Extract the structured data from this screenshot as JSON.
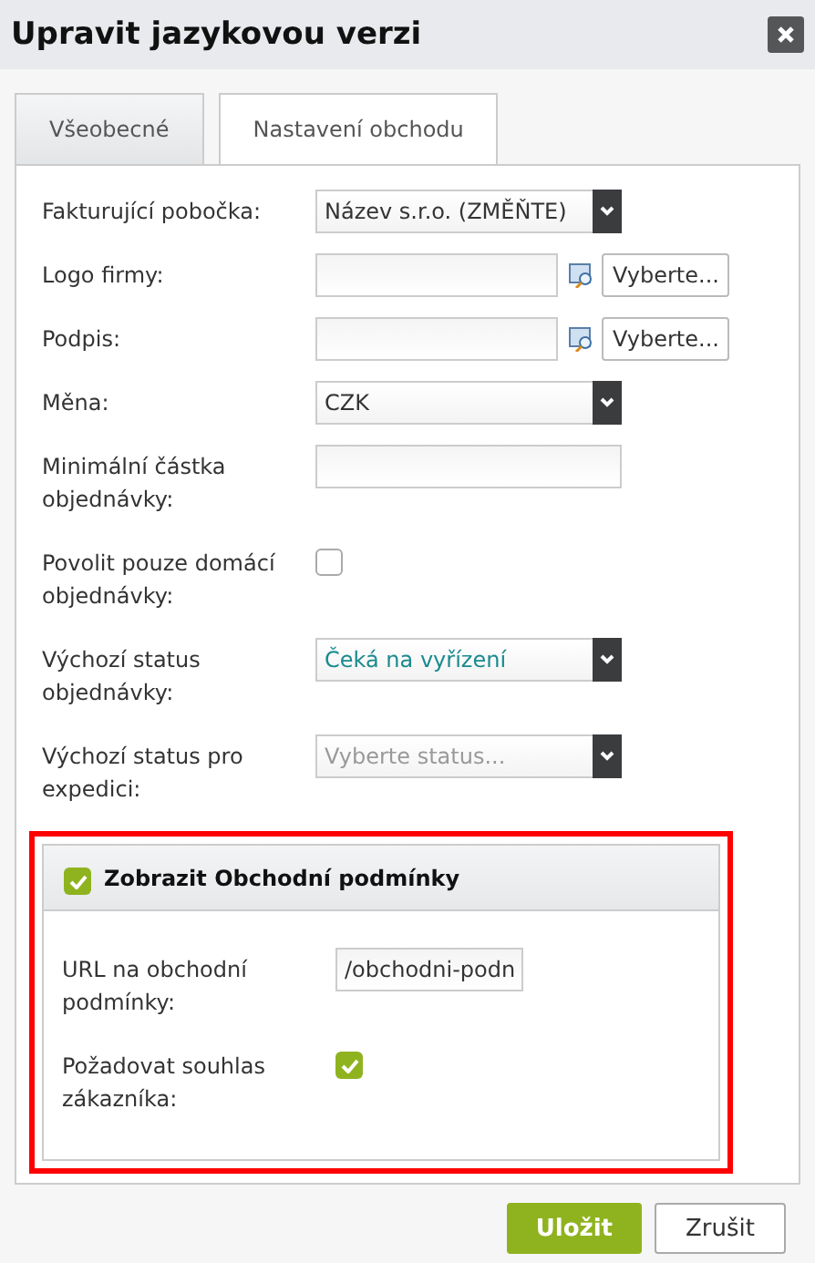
{
  "dialog": {
    "title": "Upravit jazykovou verzi"
  },
  "tabs": [
    {
      "label": "Všeobecné",
      "selected": false
    },
    {
      "label": "Nastavení obchodu",
      "selected": true
    }
  ],
  "fields": [
    {
      "kind": "select",
      "label": "Fakturující pobočka:",
      "value": "Název s.r.o. (ZMĚŇTE)"
    },
    {
      "kind": "file",
      "label": "Logo firmy:",
      "button": "Vyberte..."
    },
    {
      "kind": "file",
      "label": "Podpis:",
      "button": "Vyberte..."
    },
    {
      "kind": "select",
      "label": "Měna:",
      "value": "CZK"
    },
    {
      "kind": "text",
      "label": "Minimální částka objednávky:"
    },
    {
      "kind": "checkbox",
      "label": "Povolit pouze domácí objednávky:",
      "checked": false
    },
    {
      "kind": "select",
      "label": "Výchozí status objednávky:",
      "value": "Čeká na vyřízení",
      "accent": true
    },
    {
      "kind": "select",
      "label": "Výchozí status pro expedici:",
      "placeholder": "Vyberte status..."
    }
  ],
  "section": {
    "title": "Zobrazit Obchodní podmínky",
    "checked": true,
    "highlighted": true,
    "fields": [
      {
        "kind": "text",
        "label": "URL na obchodní podmínky:",
        "value": "/obchodni-podn"
      },
      {
        "kind": "checkbox",
        "label": "Požadovat souhlas zákazníka:",
        "checked": true
      }
    ]
  },
  "buttons": [
    {
      "label": "Uložit",
      "kind": "primary"
    },
    {
      "label": "Zrušit",
      "kind": "secondary"
    }
  ]
}
